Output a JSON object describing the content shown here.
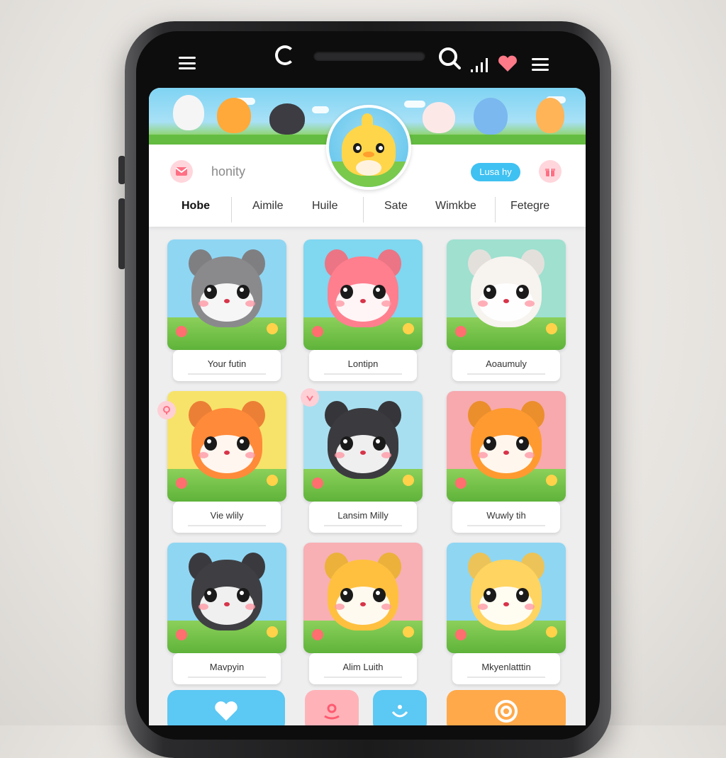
{
  "header": {
    "search_text": "honity",
    "pill_label": "Lusa hy",
    "tabs": [
      "Hobe",
      "Aimile",
      "Huile",
      "Sate",
      "Wimkbe",
      "Fetegre"
    ]
  },
  "cards": [
    {
      "label": "Your futin",
      "color": "#8a8a8d",
      "bg": "#8fd6f3"
    },
    {
      "label": "Lontipn",
      "color": "#ff7f8f",
      "bg": "#7fd7f0"
    },
    {
      "label": "Aoaumuly",
      "color": "#f7f3ef",
      "bg": "#9fe0cf"
    },
    {
      "label": "Vie wlily",
      "color": "#ff8a3a",
      "bg": "#f7e36a"
    },
    {
      "label": "Lansim Milly",
      "color": "#3b3b3f",
      "bg": "#a8dff0"
    },
    {
      "label": "Wuwly tih",
      "color": "#ff9a30",
      "bg": "#f7a9ad"
    },
    {
      "label": "Mavpyin",
      "color": "#3f3f43",
      "bg": "#8fd6f3"
    },
    {
      "label": "Alim Luith",
      "color": "#ffc040",
      "bg": "#f8b0b4"
    },
    {
      "label": "Mkyenlatttin",
      "color": "#ffd460",
      "bg": "#8fd6f3"
    }
  ],
  "bottom_buttons": [
    {
      "name": "like-button",
      "color": "#5cc8f4",
      "icon": "heart-icon"
    },
    {
      "name": "gift-button",
      "color": "#ffb3b8",
      "icon": "gift-icon"
    },
    {
      "name": "smile-button",
      "color": "#5cc8f4",
      "icon": "smile-icon"
    },
    {
      "name": "target-button",
      "color": "#ffa94a",
      "icon": "target-icon"
    }
  ],
  "colors": {
    "accent_blue": "#3fc1f2",
    "accent_pink": "#ffd6dc"
  }
}
